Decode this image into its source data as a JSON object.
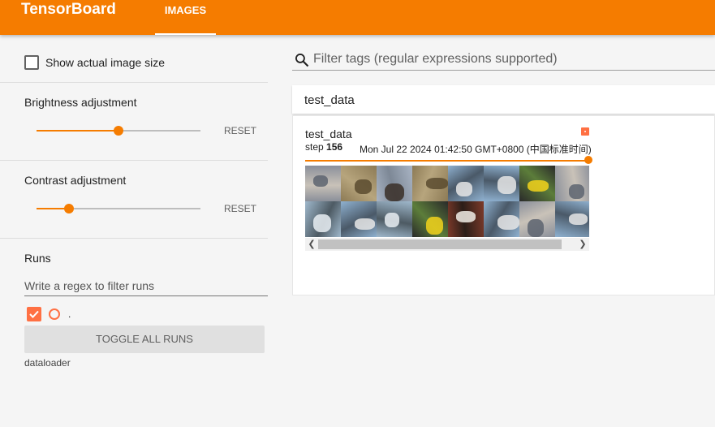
{
  "app": {
    "title": "TensorBoard",
    "tabs": [
      {
        "label": "IMAGES",
        "active": true
      }
    ],
    "accent": "#f57c00",
    "run_color": "#ff7043"
  },
  "sidebar": {
    "show_actual_size": {
      "label": "Show actual image size",
      "checked": false
    },
    "brightness": {
      "title": "Brightness adjustment",
      "reset": "RESET",
      "value": 0.5
    },
    "contrast": {
      "title": "Contrast adjustment",
      "reset": "RESET",
      "value": 0.2
    },
    "runs": {
      "title": "Runs",
      "filter_placeholder": "Write a regex to filter runs",
      "items": [
        {
          "name": ".",
          "checked": true
        }
      ],
      "toggle_label": "TOGGLE ALL RUNS",
      "group_label": "dataloader"
    }
  },
  "main": {
    "search": {
      "placeholder": "Filter tags (regular expressions supported)",
      "icon": "search-icon"
    },
    "tag_group": {
      "title": "test_data"
    },
    "card": {
      "name": "test_data",
      "step_label": "step",
      "step": "156",
      "timestamp": "Mon Jul 22 2024 01:42:50 GMT+0800 (中国标准时间)",
      "step_fraction": 1.0,
      "images": [
        "cat",
        "deer",
        "horse",
        "deer",
        "ship",
        "ship",
        "automobile",
        "cat",
        "airplane",
        "ship",
        "airplane",
        "automobile",
        "dog",
        "ship",
        "cat",
        "ship"
      ]
    }
  }
}
